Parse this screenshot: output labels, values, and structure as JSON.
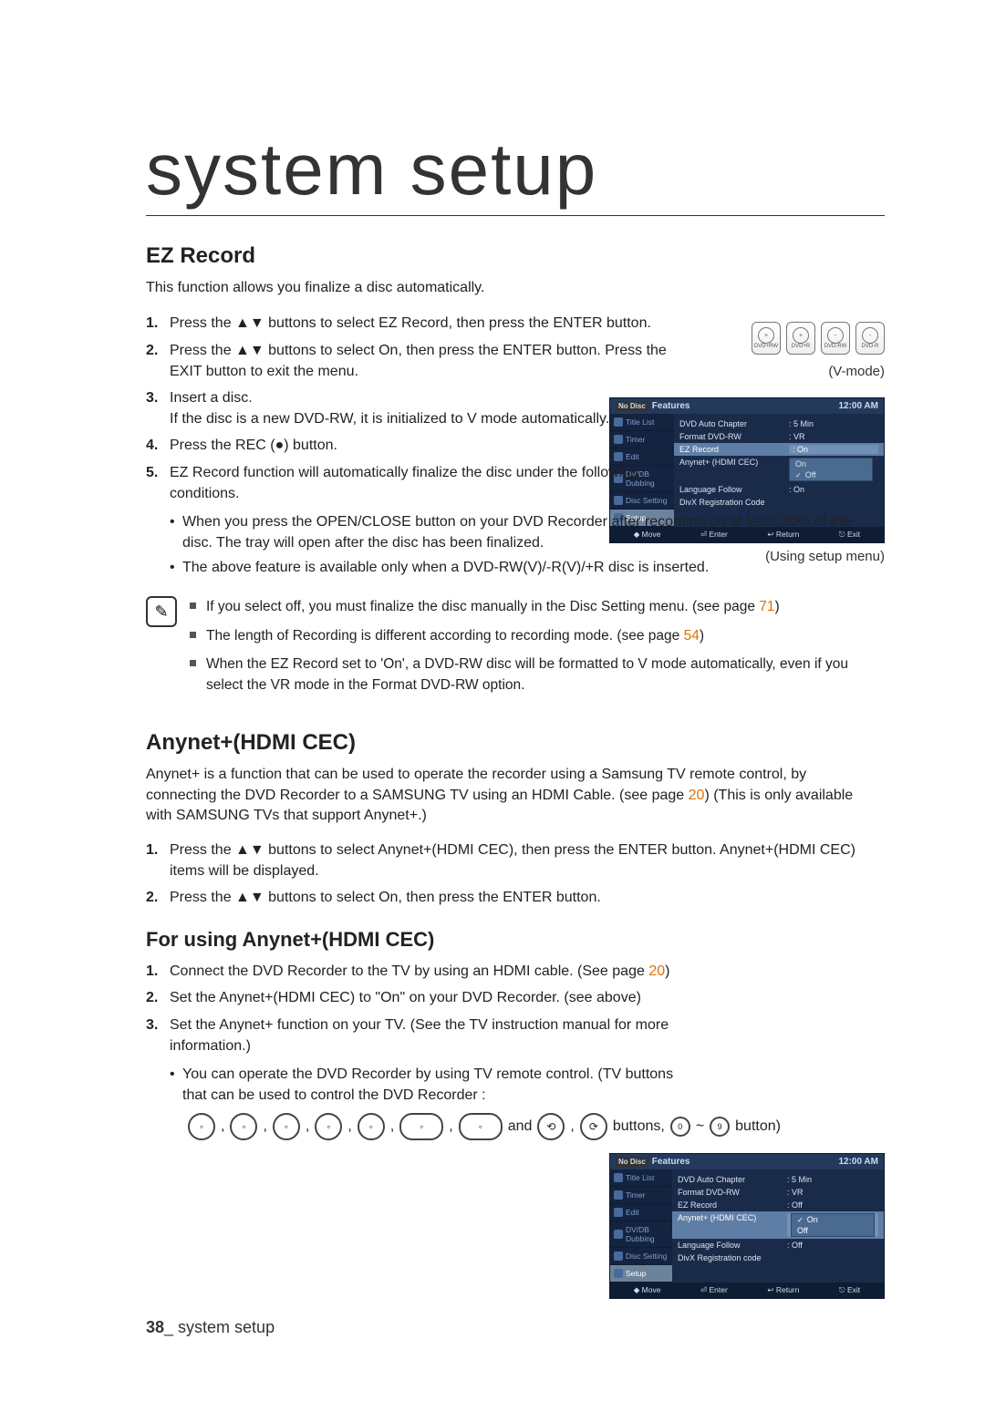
{
  "title_main": "system setup",
  "ez": {
    "heading": "EZ Record",
    "intro": "This function allows you finalize a disc automatically.",
    "vmode": "(V-mode)",
    "steps": [
      "Press the ▲▼ buttons to select EZ Record, then press the ENTER button.",
      "Press the ▲▼ buttons to select On, then press the ENTER button. Press the EXIT button to exit the menu.",
      "Insert a disc.\nIf the disc is a new DVD-RW, it is initialized to V mode automatically.",
      "Press the REC (●) button.",
      "EZ Record function will automatically finalize the disc under the following conditions."
    ],
    "bullets": [
      "When you press the OPEN/CLOSE button on your DVD Recorder after recording on at least 30% of the disc. The tray will open after the disc has been finalized.",
      "The above feature is available only when a DVD-RW(V)/-R(V)/+R disc is inserted."
    ],
    "notes": [
      "If you select off, you must finalize the disc manually in the Disc Setting menu. (see page 71)",
      "The length of Recording is different according to recording mode. (see page 54)",
      "When the EZ Record set to 'On', a DVD-RW disc will be formatted to V mode automatically, even if you select the VR mode in the Format DVD-RW option."
    ],
    "note_refs": [
      "71",
      "54"
    ]
  },
  "anynet": {
    "heading": "Anynet+(HDMI CEC)",
    "intro": "Anynet+ is a function that can be used to operate the recorder using a Samsung TV remote control, by connecting the DVD Recorder to a SAMSUNG TV using an HDMI Cable. (see page 20) (This is only available with SAMSUNG TVs that support Anynet+.)",
    "intro_ref": "20",
    "steps": [
      "Press the ▲▼ buttons to select Anynet+(HDMI CEC), then press the ENTER button. Anynet+(HDMI CEC) items will be displayed.",
      "Press the ▲▼ buttons to select On, then press the ENTER button."
    ]
  },
  "using": {
    "heading": "For using Anynet+(HDMI CEC)",
    "steps": [
      "Connect the DVD Recorder to the TV by using an HDMI cable. (See page 20)",
      "Set the Anynet+(HDMI CEC) to \"On\" on your DVD Recorder. (see above)",
      "Set the Anynet+ function on your TV. (See the TV instruction manual for more information.)"
    ],
    "step_ref": "20",
    "bullet": "You can operate the DVD Recorder by using TV remote control. (TV buttons that can be used to control the DVD Recorder :",
    "remote_tail_and": " and ",
    "remote_tail_buttons": " buttons, ",
    "remote_tail_end": " button)"
  },
  "disc_badges": [
    "DVD+RW",
    "DVD+R",
    "DVD-RW",
    "DVD-R"
  ],
  "osd1": {
    "nodisc": "No Disc",
    "features": "Features",
    "time": "12:00 AM",
    "left": [
      "Title List",
      "Timer",
      "Edit",
      "DV/DB Dubbing",
      "Disc Setting",
      "Setup"
    ],
    "rows": [
      {
        "k": "DVD Auto Chapter",
        "v": ": 5 Min"
      },
      {
        "k": "Format DVD-RW",
        "v": ": VR"
      },
      {
        "k": "EZ Record",
        "v": ": On",
        "hl": true
      },
      {
        "k": "Anynet+ (HDMI CEC)",
        "v": "",
        "sub": [
          {
            "t": "On"
          },
          {
            "t": "Off",
            "sel": true
          }
        ]
      },
      {
        "k": "Language Follow",
        "v": ": On"
      },
      {
        "k": "DivX Registration Code",
        "v": ""
      }
    ],
    "footer": [
      "◆ Move",
      "⏎ Enter",
      "↩ Return",
      "⎋ Exit"
    ],
    "caption": "(Using setup menu)"
  },
  "osd2": {
    "nodisc": "No Disc",
    "features": "Features",
    "time": "12:00 AM",
    "left": [
      "Title List",
      "Timer",
      "Edit",
      "DV/DB Dubbing",
      "Disc Setting",
      "Setup"
    ],
    "rows": [
      {
        "k": "DVD Auto Chapter",
        "v": ": 5 Min"
      },
      {
        "k": "Format DVD-RW",
        "v": ": VR"
      },
      {
        "k": "EZ Record",
        "v": ": Off"
      },
      {
        "k": "Anynet+ (HDMI CEC)",
        "v": "",
        "hl": true,
        "sub": [
          {
            "t": "On",
            "sel": true
          },
          {
            "t": "Off"
          }
        ]
      },
      {
        "k": "Language Follow",
        "v": ": Off"
      },
      {
        "k": "DivX Registration code",
        "v": ""
      }
    ],
    "footer": [
      "◆ Move",
      "⏎ Enter",
      "↩ Return",
      "⎋ Exit"
    ]
  },
  "footer": {
    "num": "38",
    "label": "_ system setup"
  }
}
